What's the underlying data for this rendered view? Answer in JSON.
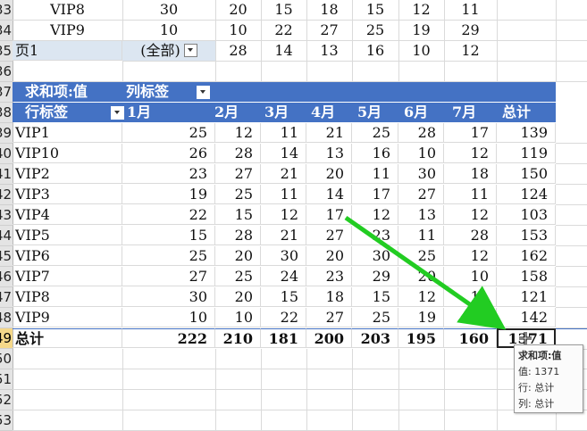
{
  "sheet": {
    "top_rows": [
      {
        "row": "33",
        "label": "VIP8",
        "v": "30",
        "cols": [
          "20",
          "15",
          "18",
          "15",
          "12",
          "11"
        ]
      },
      {
        "row": "34",
        "label": "VIP9",
        "v": "10",
        "cols": [
          "10",
          "22",
          "27",
          "25",
          "19",
          "29"
        ]
      },
      {
        "row": "35",
        "label": "页1",
        "v": "(全部)",
        "cols": [
          "28",
          "14",
          "13",
          "16",
          "10",
          "12"
        ]
      }
    ],
    "pivot_header_row": {
      "row": "37",
      "title": "求和项:值",
      "col_label": "列标签"
    },
    "pivot_cols_row": {
      "row": "38",
      "row_label": "行标签",
      "months": [
        "1月",
        "2月",
        "3月",
        "4月",
        "5月",
        "6月",
        "7月"
      ],
      "total": "总计"
    },
    "pivot_rows": [
      {
        "row": "39",
        "label": "VIP1",
        "vals": [
          "25",
          "12",
          "11",
          "21",
          "25",
          "28",
          "17"
        ],
        "total": "139"
      },
      {
        "row": "40",
        "label": "VIP10",
        "vals": [
          "26",
          "28",
          "14",
          "13",
          "16",
          "10",
          "12"
        ],
        "total": "119"
      },
      {
        "row": "41",
        "label": "VIP2",
        "vals": [
          "23",
          "27",
          "21",
          "20",
          "11",
          "30",
          "18"
        ],
        "total": "150"
      },
      {
        "row": "42",
        "label": "VIP3",
        "vals": [
          "19",
          "25",
          "11",
          "14",
          "17",
          "27",
          "11"
        ],
        "total": "124"
      },
      {
        "row": "43",
        "label": "VIP4",
        "vals": [
          "22",
          "15",
          "12",
          "17",
          "12",
          "13",
          "12"
        ],
        "total": "103"
      },
      {
        "row": "44",
        "label": "VIP5",
        "vals": [
          "15",
          "28",
          "21",
          "27",
          "23",
          "11",
          "28"
        ],
        "total": "153"
      },
      {
        "row": "45",
        "label": "VIP6",
        "vals": [
          "25",
          "20",
          "30",
          "20",
          "30",
          "25",
          "12"
        ],
        "total": "162"
      },
      {
        "row": "46",
        "label": "VIP7",
        "vals": [
          "27",
          "25",
          "24",
          "23",
          "29",
          "20",
          "10"
        ],
        "total": "158"
      },
      {
        "row": "47",
        "label": "VIP8",
        "vals": [
          "30",
          "20",
          "15",
          "18",
          "15",
          "12",
          "11"
        ],
        "total": "121"
      },
      {
        "row": "48",
        "label": "VIP9",
        "vals": [
          "10",
          "10",
          "22",
          "27",
          "25",
          "19",
          "29"
        ],
        "total": "142"
      }
    ],
    "grand_total_row": {
      "row": "49",
      "label": "总计",
      "vals": [
        "222",
        "210",
        "181",
        "200",
        "203",
        "195",
        "160"
      ],
      "total": "1371"
    },
    "empty_rows": [
      "50",
      "51",
      "52",
      "53"
    ],
    "row_36": "36"
  },
  "tooltip": {
    "line1": "求和项:值",
    "line2": "值: 1371",
    "line3": "行: 总计",
    "line4": "列: 总计"
  },
  "colors": {
    "pivot_header": "#4472c4",
    "arrow": "#22cc22"
  }
}
